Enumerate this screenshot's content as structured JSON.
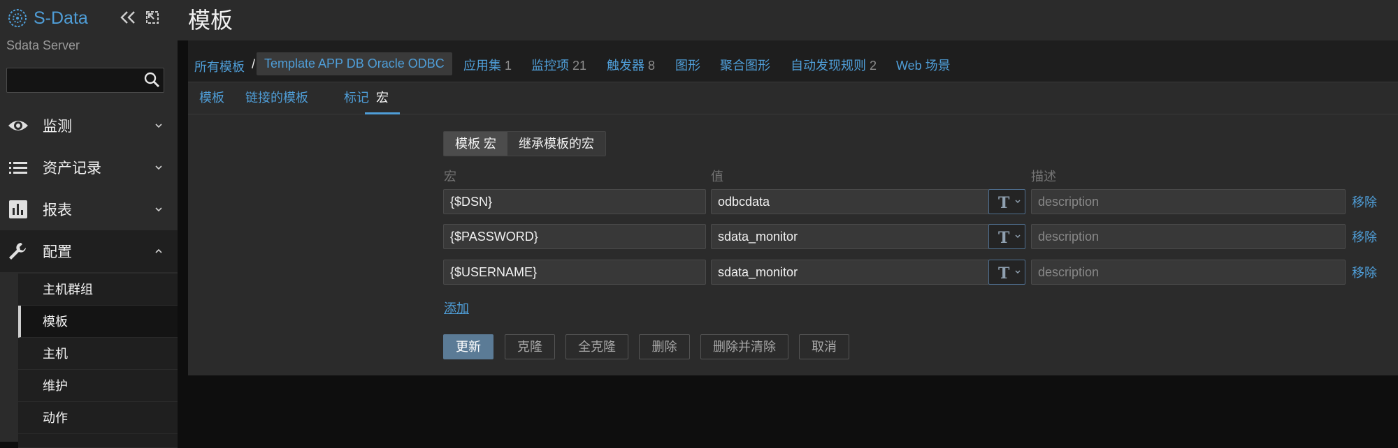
{
  "app": {
    "logo": "S-Data",
    "server_name": "Sdata Server"
  },
  "search": {
    "value": "",
    "placeholder": ""
  },
  "menu": [
    {
      "label": "监测",
      "icon": "eye-icon",
      "expanded": false
    },
    {
      "label": "资产记录",
      "icon": "list-icon",
      "expanded": false
    },
    {
      "label": "报表",
      "icon": "bar-chart-icon",
      "expanded": false
    },
    {
      "label": "配置",
      "icon": "wrench-icon",
      "expanded": true
    }
  ],
  "submenu": [
    {
      "label": "主机群组"
    },
    {
      "label": "模板",
      "active": true
    },
    {
      "label": "主机"
    },
    {
      "label": "维护"
    },
    {
      "label": "动作"
    }
  ],
  "page": {
    "title": "模板"
  },
  "breadcrumb": {
    "root": "所有模板",
    "sep": "/",
    "current": "Template APP DB Oracle ODBC"
  },
  "nav": {
    "apps": {
      "label": "应用集",
      "count": "1"
    },
    "items": {
      "label": "监控项",
      "count": "21"
    },
    "triggers": {
      "label": "触发器",
      "count": "8"
    },
    "graphs": {
      "label": "图形"
    },
    "screens": {
      "label": "聚合图形"
    },
    "discovery": {
      "label": "自动发现规则",
      "count": "2"
    },
    "web": {
      "label": "Web 场景"
    }
  },
  "tabs": [
    "模板",
    "链接的模板",
    "标记",
    "宏"
  ],
  "active_tab": "宏",
  "macro_view": {
    "own": "模板 宏",
    "inherited": "继承模板的宏"
  },
  "columns": {
    "macro": "宏",
    "value": "值",
    "description": "描述"
  },
  "macros": [
    {
      "macro": "{$DSN}",
      "value": "odbcdata",
      "description_placeholder": "description",
      "remove": "移除"
    },
    {
      "macro": "{$PASSWORD}",
      "value": "sdata_monitor",
      "description_placeholder": "description",
      "remove": "移除"
    },
    {
      "macro": "{$USERNAME}",
      "value": "sdata_monitor",
      "description_placeholder": "description",
      "remove": "移除"
    }
  ],
  "add_label": "添加",
  "buttons": {
    "update": "更新",
    "clone": "克隆",
    "full_clone": "全克隆",
    "delete": "删除",
    "delete_clear": "删除并清除",
    "cancel": "取消"
  },
  "colors": {
    "accent": "#4f9ed8",
    "primary_button": "#5b7b96",
    "sidebar_bg": "#2b2b2b",
    "page_bg": "#0e0e0e"
  }
}
